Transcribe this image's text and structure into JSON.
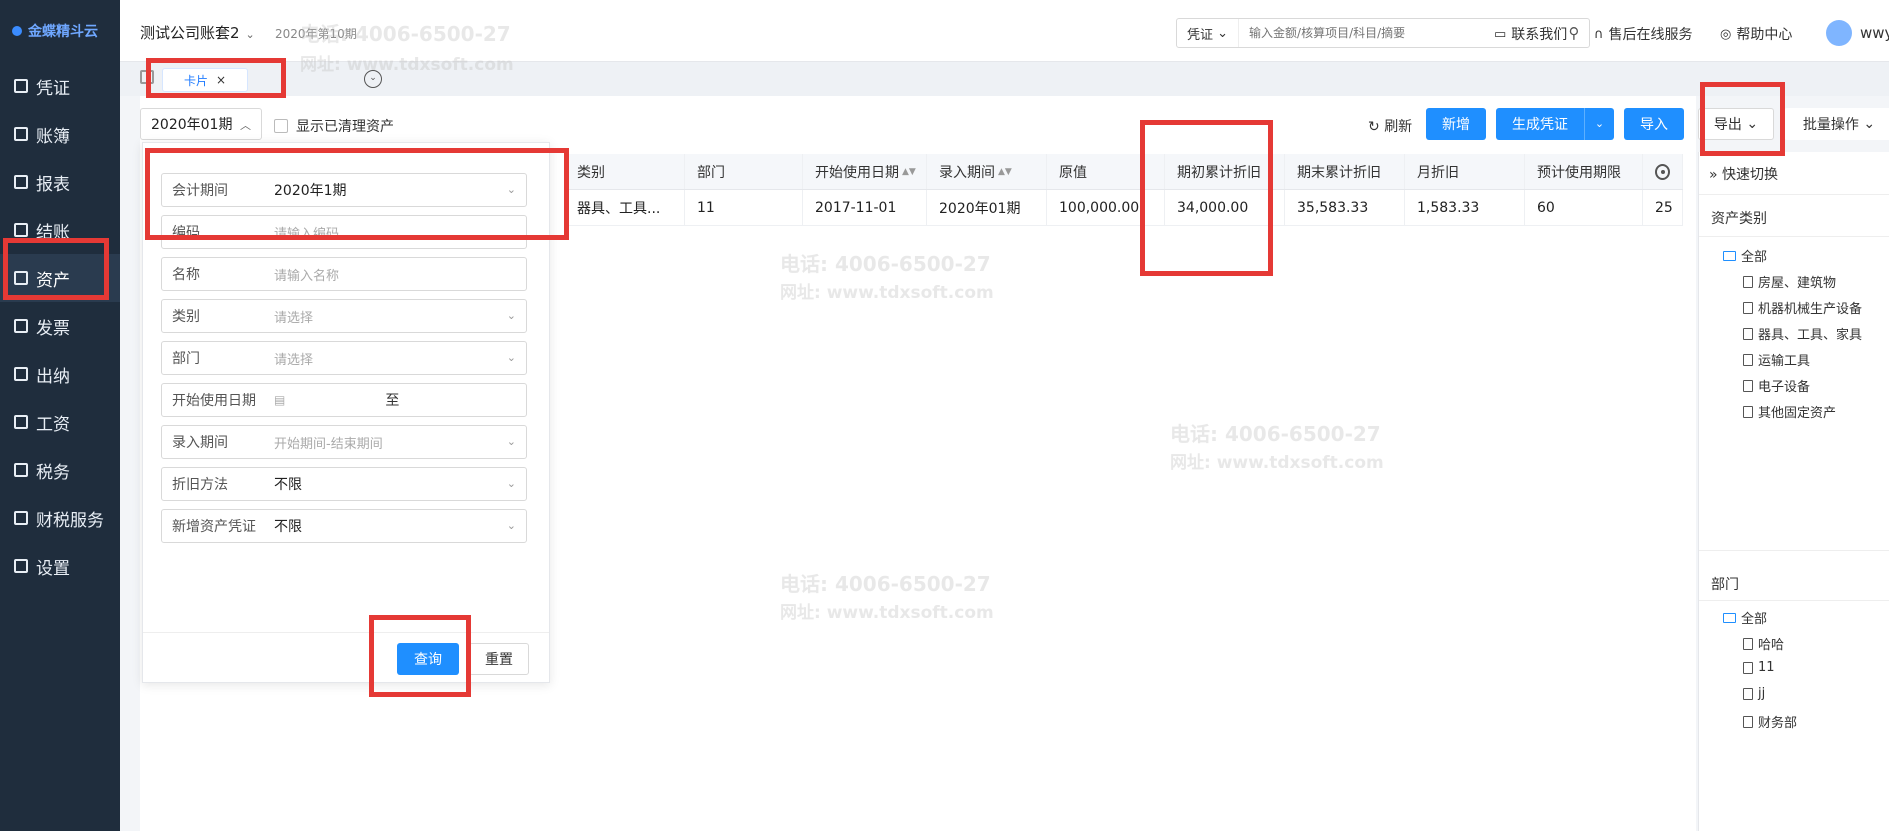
{
  "sidebar": {
    "logo": "金蝶精斗云",
    "items": [
      {
        "label": "凭证"
      },
      {
        "label": "账簿"
      },
      {
        "label": "报表"
      },
      {
        "label": "结账"
      },
      {
        "label": "资产"
      },
      {
        "label": "发票"
      },
      {
        "label": "出纳"
      },
      {
        "label": "工资"
      },
      {
        "label": "税务"
      },
      {
        "label": "财税服务"
      },
      {
        "label": "设置"
      }
    ]
  },
  "header": {
    "account": "测试公司账套2",
    "period": "2020年第10期",
    "search": {
      "type": "凭证",
      "placeholder": "输入金额/核算项目/科目/摘要"
    },
    "contact": "联系我们",
    "support": "售后在线服务",
    "help": "帮助中心",
    "user": "wwy"
  },
  "tabs": {
    "card": "卡片",
    "close": "×"
  },
  "toolbar": {
    "period": "2020年01期",
    "show_cleared": "显示已清理资产",
    "refresh": "刷新",
    "add": "新增",
    "gen_voucher": "生成凭证",
    "import": "导入",
    "export": "导出",
    "batch": "批量操作"
  },
  "table": {
    "headers": [
      "类别",
      "部门",
      "开始使用日期",
      "录入期间",
      "原值",
      "期初累计折旧",
      "期末累计折旧",
      "月折旧",
      "预计使用期限"
    ],
    "rows": [
      [
        "器具、工具...",
        "11",
        "2017-11-01",
        "2020年01期",
        "100,000.00",
        "34,000.00",
        "35,583.33",
        "1,583.33",
        "60",
        "25"
      ]
    ]
  },
  "filter": {
    "fields": [
      {
        "label": "会计期间",
        "value": "2020年1期"
      },
      {
        "label": "编码",
        "placeholder": "请输入编码"
      },
      {
        "label": "名称",
        "placeholder": "请输入名称"
      },
      {
        "label": "类别",
        "placeholder": "请选择"
      },
      {
        "label": "部门",
        "placeholder": "请选择"
      },
      {
        "label": "开始使用日期",
        "to": "至"
      },
      {
        "label": "录入期间",
        "placeholder": "开始期间-结束期间"
      },
      {
        "label": "折旧方法",
        "value": "不限"
      },
      {
        "label": "新增资产凭证",
        "value": "不限"
      }
    ],
    "query": "查询",
    "reset": "重置"
  },
  "right_panel": {
    "quick_switch": "快速切换",
    "asset_category_title": "资产类别",
    "categories": [
      "全部",
      "房屋、建筑物",
      "机器机械生产设备",
      "器具、工具、家具",
      "运输工具",
      "电子设备",
      "其他固定资产"
    ],
    "department_title": "部门",
    "departments": [
      "全部",
      "哈哈",
      "11",
      "jj",
      "财务部"
    ]
  },
  "watermark": {
    "phone": "电话: 4006-6500-27",
    "site": "网址: www.tdxsoft.com"
  }
}
